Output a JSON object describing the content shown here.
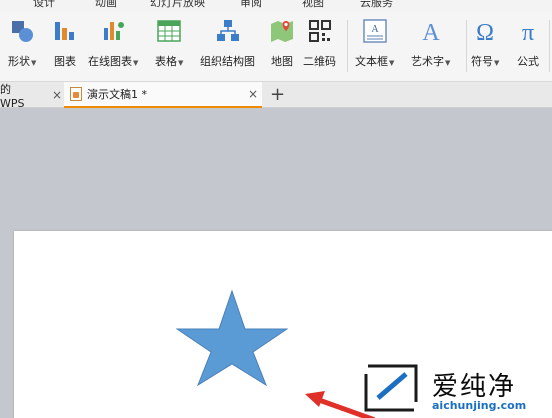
{
  "menubar": {
    "tabs": [
      "设计",
      "动画",
      "幻灯片放映",
      "审阅",
      "视图",
      "云服务"
    ]
  },
  "ribbon": {
    "shapes": "形状",
    "chart": "图表",
    "online_chart": "在线图表",
    "table": "表格",
    "org_chart": "组织结构图",
    "map": "地图",
    "qrcode": "二维码",
    "textbox": "文本框",
    "wordart": "艺术字",
    "symbol": "符号",
    "formula": "公式"
  },
  "tabs": {
    "wps_tab": "的WPS",
    "doc_tab": "演示文稿1 *",
    "close": "×",
    "add": "+"
  },
  "watermark": {
    "text": "爱纯净",
    "url": "aichunjing.com"
  },
  "colors": {
    "star": "#5b9bd5",
    "arrow": "#e0302a",
    "accent": "#f08a00"
  }
}
